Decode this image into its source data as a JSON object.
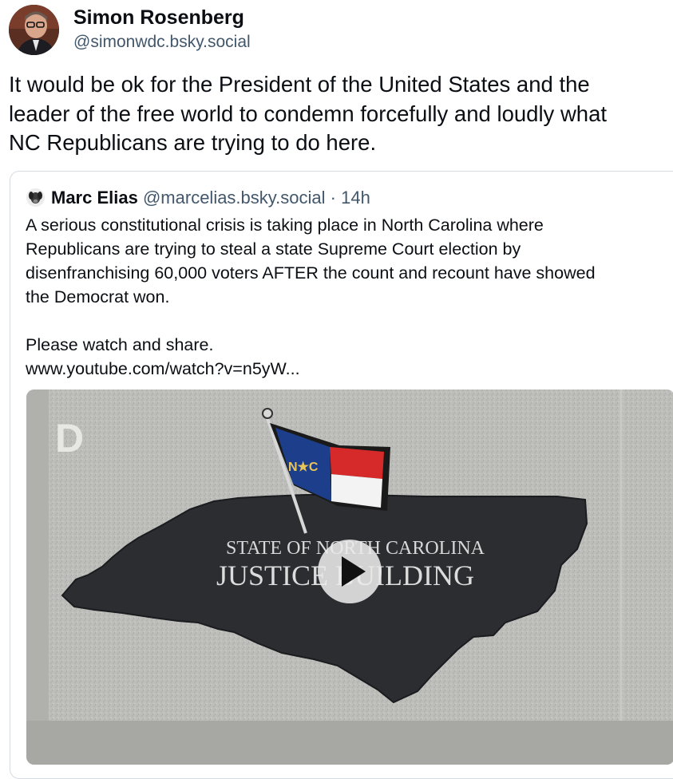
{
  "post": {
    "author_name": "Simon Rosenberg",
    "author_handle": "@simonwdc.bsky.social",
    "text_lines": [
      "It would be ok for the President of the United States and the",
      "leader of the free world to condemn forcefully and loudly what",
      "NC Republicans are trying to do here."
    ]
  },
  "quote": {
    "author_name": "Marc Elias",
    "author_handle": "@marcelias.bsky.social",
    "separator": "·",
    "time": "14h",
    "text_lines": [
      "A serious constitutional crisis is taking place in North Carolina where",
      "Republicans are trying to steal a state Supreme Court election by",
      "disenfranchising 60,000 voters AFTER the count and recount have showed",
      "the Democrat won.",
      "",
      "Please watch and share.",
      "www.youtube.com/watch?v=n5yW..."
    ],
    "video": {
      "corner_mark": "D",
      "sign_line1": "STATE OF NORTH CAROLINA",
      "sign_line2": "JUSTICE BUILDING",
      "flag_text": "N★C"
    }
  },
  "colors": {
    "text": "#0b0f14",
    "muted": "#42576c",
    "border": "#d4dbe2",
    "flag_blue": "#1d3e8a",
    "flag_red": "#d62a2a"
  }
}
